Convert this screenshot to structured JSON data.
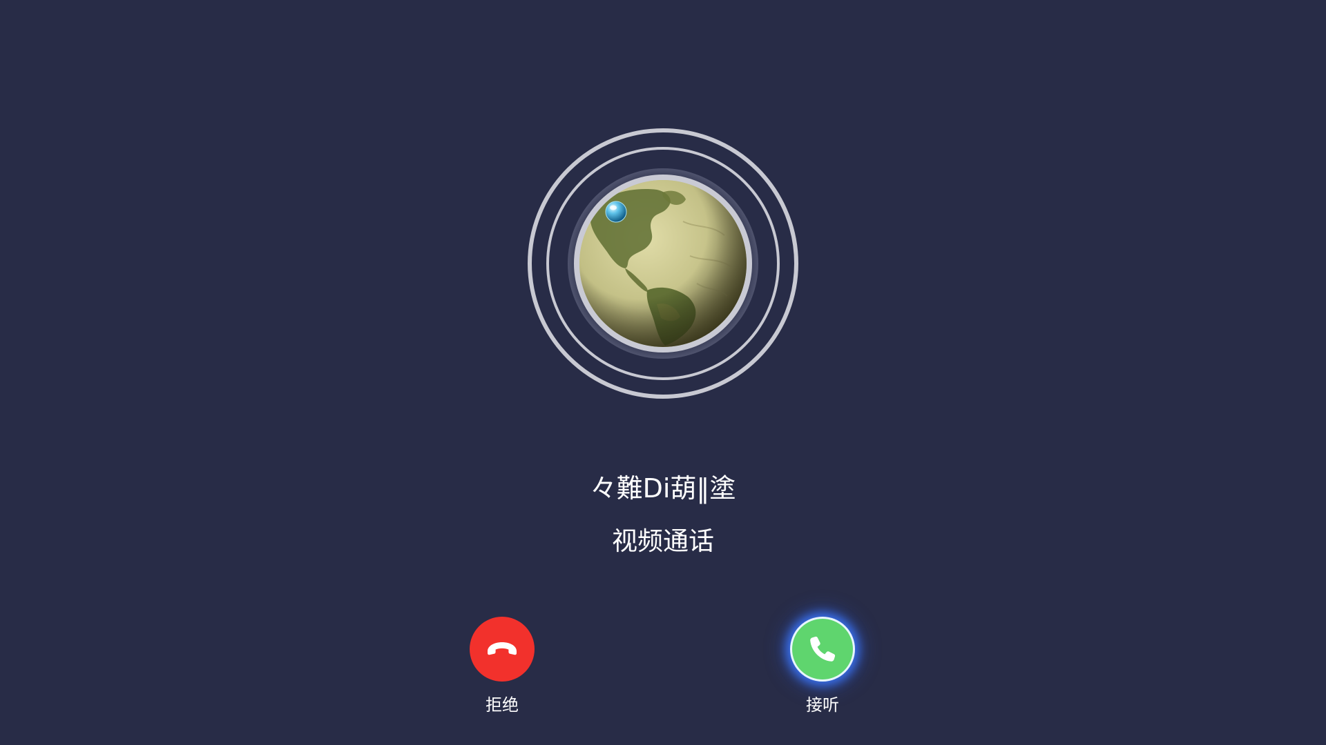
{
  "contact": {
    "name": "々難Di葫‖塗",
    "call_type": "视频通话"
  },
  "avatar": {
    "icon": "globe-avatar-icon",
    "description_icon": "earth-globe"
  },
  "actions": {
    "decline": {
      "label": "拒绝",
      "icon": "hang-up-icon",
      "color": "#f2312c"
    },
    "accept": {
      "label": "接听",
      "icon": "phone-icon",
      "color": "#5fd56e",
      "glow_color": "#3c78ff"
    }
  },
  "colors": {
    "background": "#282c47",
    "ring": "#c8c9d2"
  }
}
